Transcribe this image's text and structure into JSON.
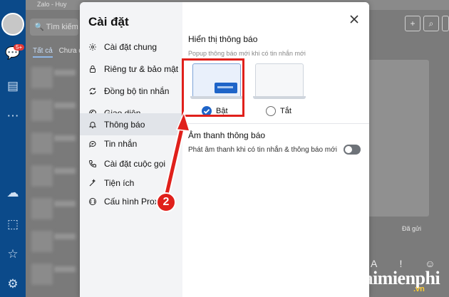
{
  "app": {
    "window_title": "Zalo - Huy"
  },
  "left_rail": {
    "badge": "5+"
  },
  "chat_list": {
    "search_placeholder": "Tìm kiếm",
    "tabs": [
      "Tất cả",
      "Chưa đ"
    ]
  },
  "right_pane": {
    "status_text": "Đã gửi",
    "tool_glyphs": "A ! ☺"
  },
  "settings": {
    "title": "Cài đặt",
    "nav": [
      {
        "label": "Cài đặt chung",
        "icon": "gear-icon"
      },
      {
        "label": "Riêng tư & bảo mật",
        "icon": "lock-icon"
      },
      {
        "label": "Đồng bộ tin nhắn",
        "icon": "sync-icon"
      },
      {
        "label": "Giao diện",
        "icon": "palette-icon"
      },
      {
        "label": "Thông báo",
        "icon": "bell-icon",
        "active": true
      },
      {
        "label": "Tin nhắn",
        "icon": "chat-bubble-icon"
      },
      {
        "label": "Cài đặt cuộc gọi",
        "icon": "phone-icon"
      },
      {
        "label": "Tiện ích",
        "icon": "wand-icon"
      },
      {
        "label": "Cấu hình Proxy",
        "icon": "proxy-icon"
      }
    ],
    "display_section": {
      "title": "Hiển thị thông báo",
      "description": "Popup thông báo mới khi có tin nhắn mới",
      "options": [
        {
          "label": "Bật",
          "selected": true
        },
        {
          "label": "Tắt",
          "selected": false
        }
      ]
    },
    "sound_section": {
      "title": "Âm thanh thông báo",
      "toggle_label": "Phát âm thanh khi có tin nhắn & thông báo mới",
      "toggle_on": false
    }
  },
  "annotation": {
    "step": "2",
    "color": "#e0201b"
  },
  "watermark": {
    "brand": "Taimienphi",
    "tld": ".vn"
  },
  "colors": {
    "accent": "#1e64c8",
    "rail": "#0b4a8a"
  }
}
